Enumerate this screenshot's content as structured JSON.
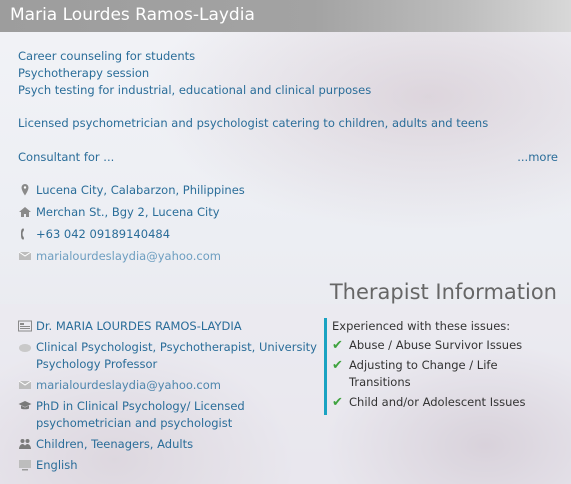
{
  "header": {
    "name": "Maria Lourdes Ramos-Laydia"
  },
  "services": [
    "Career counseling for students",
    "Psychotherapy session",
    "Psych testing for industrial, educational and clinical purposes"
  ],
  "summary": "Licensed psychometrician and psychologist catering to children, adults and teens",
  "consultant": "Consultant for ...",
  "more_link": "...more",
  "contact": {
    "location": "Lucena City, Calabarzon, Philippines",
    "address": "Merchan St., Bgy 2, Lucena City",
    "phone": "+63 042 09189140484",
    "email": "marialourdeslaydia@yahoo.com"
  },
  "therapist": {
    "section_title": "Therapist Information",
    "name": "Dr. MARIA LOURDES RAMOS-LAYDIA",
    "profession": "Clinical Psychologist, Psychotherapist, University Psychology Professor",
    "email": "marialourdeslaydia@yahoo.com",
    "education": "PhD in Clinical Psychology/ Licensed psychometrician and psychologist",
    "clients": "Children, Teenagers, Adults",
    "language": "English"
  },
  "issues": {
    "header": "Experienced with these issues:",
    "items": [
      "Abuse / Abuse Survivor Issues",
      "Adjusting to Change / Life Transitions",
      "Child and/or Adolescent Issues"
    ]
  },
  "colors": {
    "link": "#2a6d99",
    "accent_bar": "#1aa3c2",
    "check": "#3fa33f"
  }
}
